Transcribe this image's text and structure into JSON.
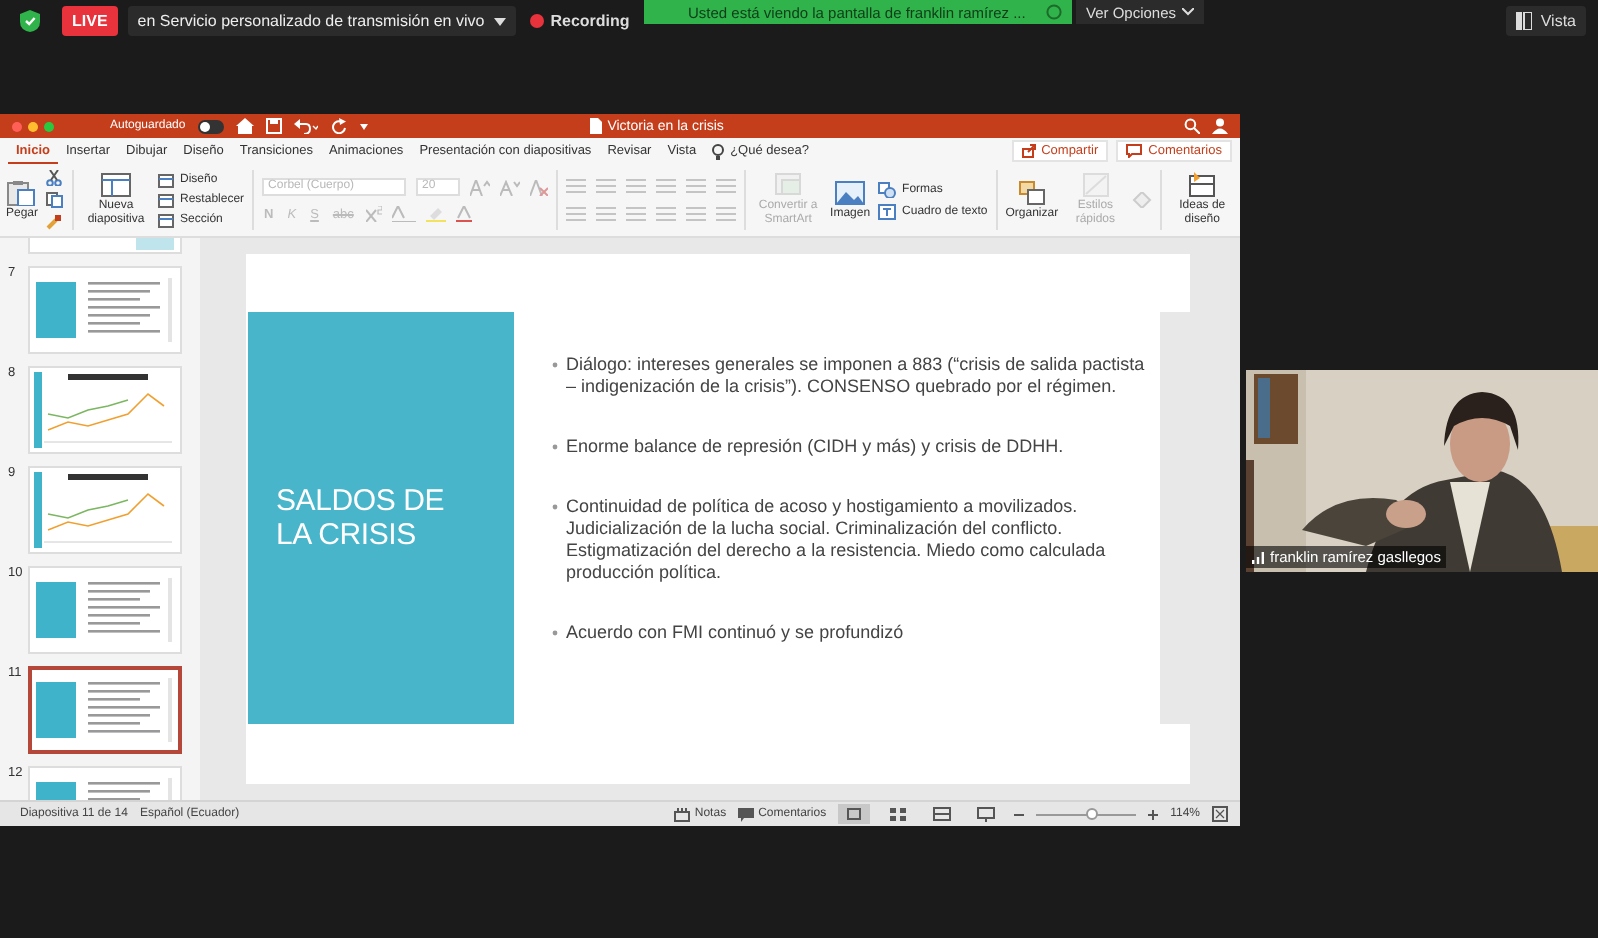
{
  "meeting_bar": {
    "live_badge": "LIVE",
    "stream_title": "en Servicio personalizado de transmisión en vivo",
    "recording": "Recording",
    "share_banner": "Usted está viendo la pantalla de franklin ramírez ...",
    "options_button": "Ver Opciones",
    "view_button": "Vista"
  },
  "app": {
    "autosave": {
      "label": "Autoguardado",
      "on": false
    },
    "title": "Victoria en la crisis",
    "tabs": [
      {
        "label": "Inicio",
        "selected": true
      },
      {
        "label": "Insertar",
        "selected": false
      },
      {
        "label": "Dibujar",
        "selected": false
      },
      {
        "label": "Diseño",
        "selected": false
      },
      {
        "label": "Transiciones",
        "selected": false
      },
      {
        "label": "Animaciones",
        "selected": false
      },
      {
        "label": "Presentación con diapositivas",
        "selected": false
      },
      {
        "label": "Revisar",
        "selected": false
      },
      {
        "label": "Vista",
        "selected": false
      }
    ],
    "search_hint": "¿Qué desea?",
    "share_button": "Compartir",
    "comments_button": "Comentarios"
  },
  "ribbon": {
    "paste": "Pegar",
    "new_slide": "Nueva diapositiva",
    "slide_commands": [
      {
        "label": "Diseño"
      },
      {
        "label": "Restablecer"
      },
      {
        "label": "Sección"
      }
    ],
    "font": {
      "value": "Corbel (Cuerpo)",
      "size": "20",
      "disabled": true
    },
    "format_keys": [
      {
        "label": "N"
      },
      {
        "label": "K"
      },
      {
        "label": "S"
      },
      {
        "label": "abc"
      }
    ],
    "groups": [
      {
        "label": "Convertir a SmartArt",
        "disabled": true
      },
      {
        "label": "Imagen",
        "disabled": false
      }
    ],
    "insert_commands": [
      {
        "label": "Formas"
      },
      {
        "label": "Cuadro de texto"
      }
    ],
    "arrange": [
      {
        "label": "Organizar",
        "disabled": false
      },
      {
        "label": "Estilos rápidos",
        "disabled": true
      },
      {
        "label": "Ideas de diseño",
        "disabled": false
      }
    ]
  },
  "slide_panel": [
    {
      "number": "7",
      "kind": "text",
      "selected": false
    },
    {
      "number": "8",
      "kind": "chart",
      "selected": false
    },
    {
      "number": "9",
      "kind": "chart",
      "selected": false
    },
    {
      "number": "10",
      "kind": "text",
      "selected": false
    },
    {
      "number": "11",
      "kind": "text",
      "selected": true
    },
    {
      "number": "12",
      "kind": "text",
      "selected": false
    }
  ],
  "slide": {
    "title": "SALDOS DE\nLA CRISIS",
    "bullets": [
      "Diálogo: intereses generales se imponen a 883 (“crisis de salida pactista – indigenización de la crisis”). CONSENSO quebrado por el régimen.",
      "Enorme balance de represión (CIDH y más) y crisis de DDHH.",
      "Continuidad de política de acoso y hostigamiento a movilizados. Judicialización de la lucha social. Criminalización del conflicto. Estigmatización del derecho a la resistencia. Miedo como calculada producción política.",
      "Acuerdo con FMI continuó y se profundizó"
    ]
  },
  "status_bar": {
    "slide_info": "Diapositiva 11 de 14",
    "language": "Español (Ecuador)",
    "notes": "Notas",
    "comments": "Comentarios",
    "views": [
      {
        "selected": true
      },
      {
        "selected": false
      },
      {
        "selected": false
      },
      {
        "selected": false
      }
    ],
    "zoom": {
      "level": 0.55,
      "reading": "114%"
    }
  },
  "participant": {
    "name": "franklin ramírez gasllegos"
  }
}
